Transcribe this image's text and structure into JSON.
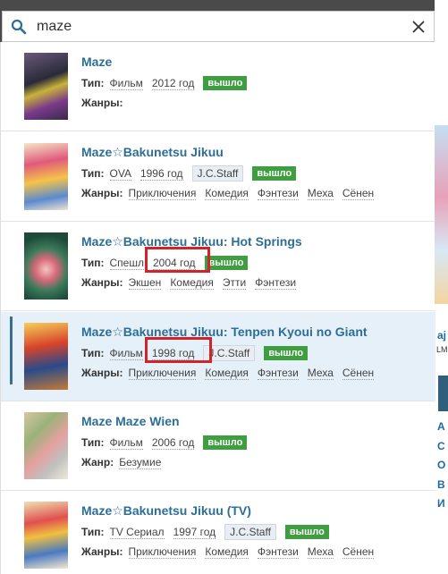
{
  "search": {
    "query": "maze"
  },
  "labels": {
    "type": "Тип:",
    "genres": "Жанры:",
    "genre": "Жанр:"
  },
  "results": [
    {
      "title": "Maze",
      "type": "Фильм",
      "year": "2012 год",
      "studio": "",
      "status": "вышло",
      "genre_label": "Жанры:",
      "genres": []
    },
    {
      "title": "Maze☆Bakunetsu Jikuu",
      "type": "OVA",
      "year": "1996 год",
      "studio": "J.C.Staff",
      "status": "вышло",
      "genre_label": "Жанры:",
      "genres": [
        "Приключения",
        "Комедия",
        "Фэнтези",
        "Меха",
        "Сёнен"
      ]
    },
    {
      "title": "Maze☆Bakunetsu Jikuu: Hot Springs",
      "type": "Спешл",
      "year": "2004 год",
      "studio": "",
      "status": "вышло",
      "genre_label": "Жанры:",
      "genres": [
        "Экшен",
        "Комедия",
        "Этти",
        "Фэнтези"
      ]
    },
    {
      "title": "Maze☆Bakunetsu Jikuu: Tenpen Kyoui no Giant",
      "type": "Фильм",
      "year": "1998 год",
      "studio": "J.C.Staff",
      "status": "вышло",
      "genre_label": "Жанры:",
      "genres": [
        "Приключения",
        "Комедия",
        "Фэнтези",
        "Меха",
        "Сёнен"
      ]
    },
    {
      "title": "Maze Maze Wien",
      "type": "Фильм",
      "year": "2006 год",
      "studio": "",
      "status": "вышло",
      "genre_label": "Жанр:",
      "genres": [
        "Безумие"
      ]
    },
    {
      "title": "Maze☆Bakunetsu Jikuu (TV)",
      "type": "TV Сериал",
      "year": "1997 год",
      "studio": "J.C.Staff",
      "status": "вышло",
      "genre_label": "Жанры:",
      "genres": [
        "Приключения",
        "Комедия",
        "Фэнтези",
        "Меха",
        "Сёнен"
      ]
    }
  ],
  "background_letters": [
    "aj",
    "LM",
    "А",
    "С",
    "О",
    "В",
    "И"
  ],
  "colors": {
    "title": "#2d6e97",
    "status": "#3f9e3f",
    "highlight": "#d2232a",
    "active_bar": "#3b6c95"
  }
}
